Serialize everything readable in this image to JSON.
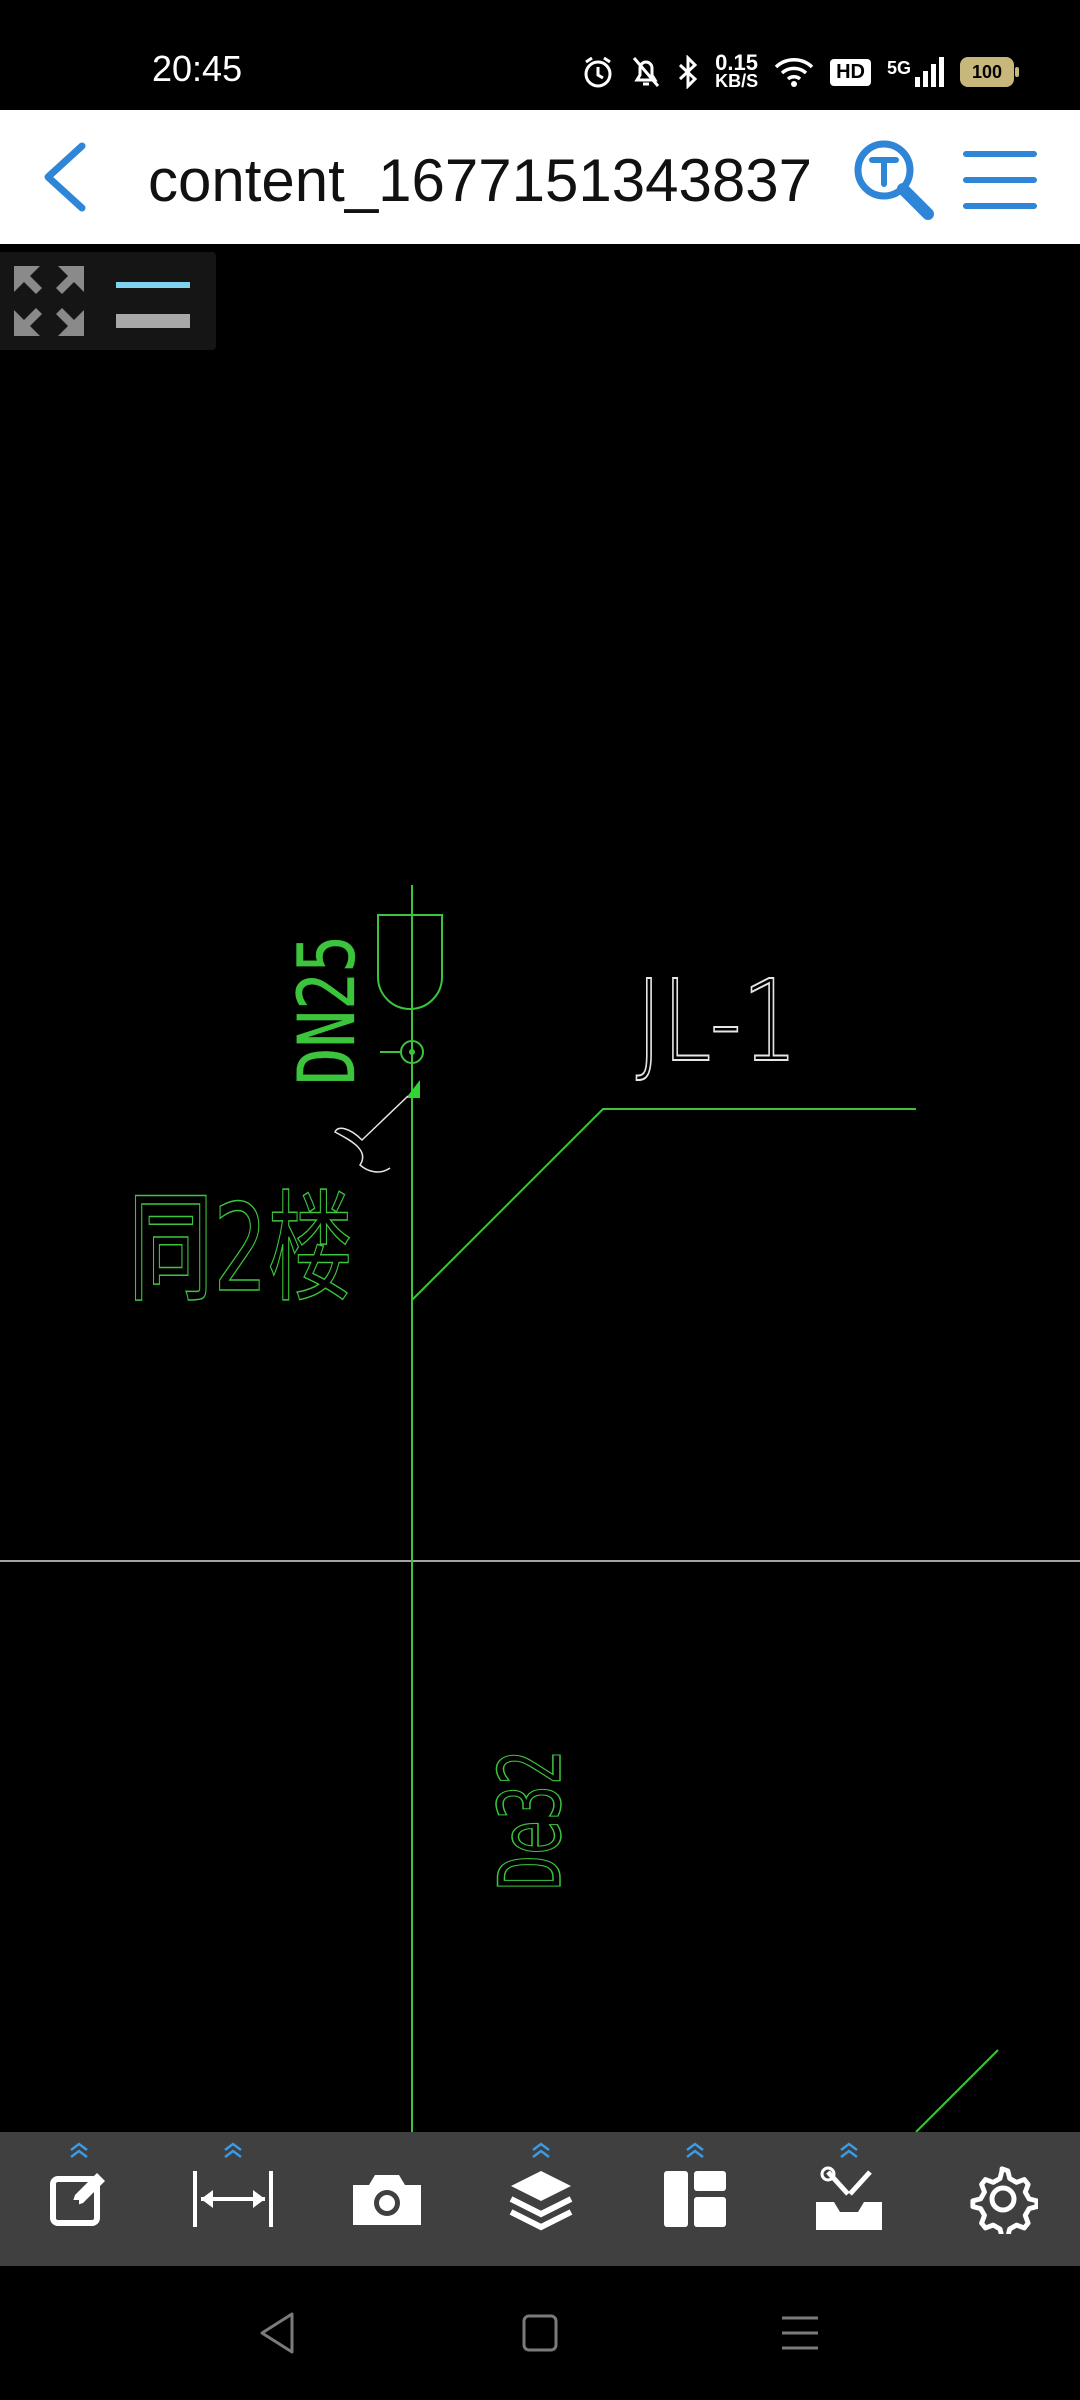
{
  "status": {
    "time": "20:45",
    "net_speed_value": "0.15",
    "net_speed_unit": "KB/S",
    "hd_badge": "HD",
    "network": "5G",
    "battery": "100"
  },
  "appbar": {
    "title": "content_1677151343837"
  },
  "drawing": {
    "label_dn25": "DN25",
    "label_jl1": "JL-1",
    "label_floor": "同2楼",
    "label_de32": "De32",
    "line_color": "#3cc43c",
    "text_color_white": "#e6e6e6"
  },
  "toolbar": {
    "items": [
      "edit-icon",
      "measure-icon",
      "camera-icon",
      "layers-icon",
      "layout-icon",
      "tools-icon",
      "settings-icon"
    ]
  },
  "colors": {
    "accent": "#2f86d6",
    "toolbar_bg": "#404040"
  }
}
